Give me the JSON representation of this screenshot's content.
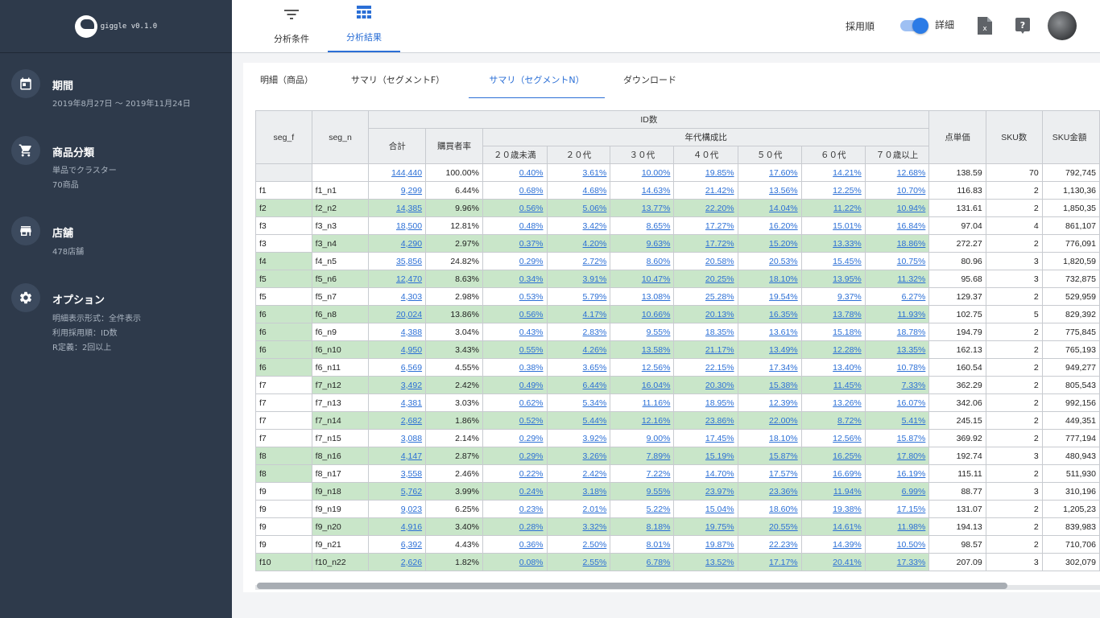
{
  "app": {
    "name": "giggle v0.1.0"
  },
  "sidebar": {
    "period": {
      "title": "期間",
      "lines": [
        "2019年8月27日 〜 2019年11月24日"
      ]
    },
    "category": {
      "title": "商品分類",
      "lines": [
        "単品でクラスター",
        "70商品"
      ]
    },
    "store": {
      "title": "店舗",
      "lines": [
        "478店舗"
      ]
    },
    "options": {
      "title": "オプション",
      "lines": [
        "明細表示形式：全件表示",
        "利用採用順：ID数",
        "R定義：2回以上"
      ]
    }
  },
  "topnav": {
    "tabs": [
      {
        "label": "分析条件",
        "icon": "filter-icon",
        "active": false
      },
      {
        "label": "分析結果",
        "icon": "table-icon",
        "active": true
      }
    ],
    "sort_label": "採用順",
    "detail_label": "詳細",
    "toggle_on": true
  },
  "subtabs": [
    {
      "label": "明細（商品）",
      "active": false
    },
    {
      "label": "サマリ（セグメントF）",
      "active": false
    },
    {
      "label": "サマリ（セグメントN）",
      "active": true
    },
    {
      "label": "ダウンロード",
      "active": false
    }
  ],
  "table": {
    "headers": {
      "seg_f": "seg_f",
      "seg_n": "seg_n",
      "id_count": "ID数",
      "total": "合計",
      "buyer_rate": "購買者率",
      "age_comp": "年代構成比",
      "ages": [
        "２０歳未満",
        "２０代",
        "３０代",
        "４０代",
        "５０代",
        "６０代",
        "７０歳以上"
      ],
      "unit_price": "点単価",
      "sku_count": "SKU数",
      "sku_amount": "SKU金額"
    },
    "total_row": {
      "seg_f": "",
      "seg_n": "",
      "total": "144,440",
      "rate": "100.00%",
      "ages": [
        "0.40%",
        "3.61%",
        "10.00%",
        "19.85%",
        "17.60%",
        "14.21%",
        "12.68%"
      ],
      "price": "138.59",
      "sku": "70",
      "amount": "792,745"
    },
    "rows": [
      {
        "f": "f1",
        "n": "f1_n1",
        "g": false,
        "total": "9,299",
        "rate": "6.44%",
        "ages": [
          "0.68%",
          "4.68%",
          "14.63%",
          "21.42%",
          "13.56%",
          "12.25%",
          "10.70%"
        ],
        "price": "116.83",
        "sku": "2",
        "amount": "1,130,36"
      },
      {
        "f": "f2",
        "n": "f2_n2",
        "g": true,
        "total": "14,385",
        "rate": "9.96%",
        "ages": [
          "0.56%",
          "5.06%",
          "13.77%",
          "22.20%",
          "14.04%",
          "11.22%",
          "10.94%"
        ],
        "price": "131.61",
        "sku": "2",
        "amount": "1,850,35"
      },
      {
        "f": "f3",
        "n": "f3_n3",
        "g": false,
        "total": "18,500",
        "rate": "12.81%",
        "ages": [
          "0.48%",
          "3.42%",
          "8.65%",
          "17.27%",
          "16.20%",
          "15.01%",
          "16.84%"
        ],
        "price": "97.04",
        "sku": "4",
        "amount": "861,107"
      },
      {
        "f": "f3",
        "n": "f3_n4",
        "g": true,
        "fg": false,
        "total": "4,290",
        "rate": "2.97%",
        "ages": [
          "0.37%",
          "4.20%",
          "9.63%",
          "17.72%",
          "15.20%",
          "13.33%",
          "18.86%"
        ],
        "price": "272.27",
        "sku": "2",
        "amount": "776,091"
      },
      {
        "f": "f4",
        "n": "f4_n5",
        "g": false,
        "fg": true,
        "total": "35,856",
        "rate": "24.82%",
        "ages": [
          "0.29%",
          "2.72%",
          "8.60%",
          "20.58%",
          "20.53%",
          "15.45%",
          "10.75%"
        ],
        "price": "80.96",
        "sku": "3",
        "amount": "1,820,59"
      },
      {
        "f": "f5",
        "n": "f5_n6",
        "g": true,
        "total": "12,470",
        "rate": "8.63%",
        "ages": [
          "0.34%",
          "3.91%",
          "10.47%",
          "20.25%",
          "18.10%",
          "13.95%",
          "11.32%"
        ],
        "price": "95.68",
        "sku": "3",
        "amount": "732,875"
      },
      {
        "f": "f5",
        "n": "f5_n7",
        "g": false,
        "total": "4,303",
        "rate": "2.98%",
        "ages": [
          "0.53%",
          "5.79%",
          "13.08%",
          "25.28%",
          "19.54%",
          "9.37%",
          "6.27%"
        ],
        "price": "129.37",
        "sku": "2",
        "amount": "529,959"
      },
      {
        "f": "f6",
        "n": "f6_n8",
        "g": true,
        "total": "20,024",
        "rate": "13.86%",
        "ages": [
          "0.56%",
          "4.17%",
          "10.66%",
          "20.13%",
          "16.35%",
          "13.78%",
          "11.93%"
        ],
        "price": "102.75",
        "sku": "5",
        "amount": "829,392"
      },
      {
        "f": "f6",
        "n": "f6_n9",
        "g": false,
        "fg": true,
        "total": "4,388",
        "rate": "3.04%",
        "ages": [
          "0.43%",
          "2.83%",
          "9.55%",
          "18.35%",
          "13.61%",
          "15.18%",
          "18.78%"
        ],
        "price": "194.79",
        "sku": "2",
        "amount": "775,845"
      },
      {
        "f": "f6",
        "n": "f6_n10",
        "g": true,
        "total": "4,950",
        "rate": "3.43%",
        "ages": [
          "0.55%",
          "4.26%",
          "13.58%",
          "21.17%",
          "13.49%",
          "12.28%",
          "13.35%"
        ],
        "price": "162.13",
        "sku": "2",
        "amount": "765,193"
      },
      {
        "f": "f6",
        "n": "f6_n11",
        "g": false,
        "fg": true,
        "total": "6,569",
        "rate": "4.55%",
        "ages": [
          "0.38%",
          "3.65%",
          "12.56%",
          "22.15%",
          "17.34%",
          "13.40%",
          "10.78%"
        ],
        "price": "160.54",
        "sku": "2",
        "amount": "949,277"
      },
      {
        "f": "f7",
        "n": "f7_n12",
        "g": true,
        "fg": false,
        "total": "3,492",
        "rate": "2.42%",
        "ages": [
          "0.49%",
          "6.44%",
          "16.04%",
          "20.30%",
          "15.38%",
          "11.45%",
          "7.33%"
        ],
        "price": "362.29",
        "sku": "2",
        "amount": "805,543"
      },
      {
        "f": "f7",
        "n": "f7_n13",
        "g": false,
        "total": "4,381",
        "rate": "3.03%",
        "ages": [
          "0.62%",
          "5.34%",
          "11.16%",
          "18.95%",
          "12.39%",
          "13.26%",
          "16.07%"
        ],
        "price": "342.06",
        "sku": "2",
        "amount": "992,156"
      },
      {
        "f": "f7",
        "n": "f7_n14",
        "g": true,
        "fg": false,
        "total": "2,682",
        "rate": "1.86%",
        "ages": [
          "0.52%",
          "5.44%",
          "12.16%",
          "23.86%",
          "22.00%",
          "8.72%",
          "5.41%"
        ],
        "price": "245.15",
        "sku": "2",
        "amount": "449,351"
      },
      {
        "f": "f7",
        "n": "f7_n15",
        "g": false,
        "total": "3,088",
        "rate": "2.14%",
        "ages": [
          "0.29%",
          "3.92%",
          "9.00%",
          "17.45%",
          "18.10%",
          "12.56%",
          "15.87%"
        ],
        "price": "369.92",
        "sku": "2",
        "amount": "777,194"
      },
      {
        "f": "f8",
        "n": "f8_n16",
        "g": true,
        "total": "4,147",
        "rate": "2.87%",
        "ages": [
          "0.29%",
          "3.26%",
          "7.89%",
          "15.19%",
          "15.87%",
          "16.25%",
          "17.80%"
        ],
        "price": "192.74",
        "sku": "3",
        "amount": "480,943"
      },
      {
        "f": "f8",
        "n": "f8_n17",
        "g": false,
        "fg": true,
        "total": "3,558",
        "rate": "2.46%",
        "ages": [
          "0.22%",
          "2.42%",
          "7.22%",
          "14.70%",
          "17.57%",
          "16.69%",
          "16.19%"
        ],
        "price": "115.11",
        "sku": "2",
        "amount": "511,930"
      },
      {
        "f": "f9",
        "n": "f9_n18",
        "g": true,
        "fg": false,
        "total": "5,762",
        "rate": "3.99%",
        "ages": [
          "0.24%",
          "3.18%",
          "9.55%",
          "23.97%",
          "23.36%",
          "11.94%",
          "6.99%"
        ],
        "price": "88.77",
        "sku": "3",
        "amount": "310,196"
      },
      {
        "f": "f9",
        "n": "f9_n19",
        "g": false,
        "total": "9,023",
        "rate": "6.25%",
        "ages": [
          "0.23%",
          "2.01%",
          "5.22%",
          "15.04%",
          "18.60%",
          "19.38%",
          "17.15%"
        ],
        "price": "131.07",
        "sku": "2",
        "amount": "1,205,23"
      },
      {
        "f": "f9",
        "n": "f9_n20",
        "g": true,
        "fg": false,
        "total": "4,916",
        "rate": "3.40%",
        "ages": [
          "0.28%",
          "3.32%",
          "8.18%",
          "19.75%",
          "20.55%",
          "14.61%",
          "11.98%"
        ],
        "price": "194.13",
        "sku": "2",
        "amount": "839,983"
      },
      {
        "f": "f9",
        "n": "f9_n21",
        "g": false,
        "total": "6,392",
        "rate": "4.43%",
        "ages": [
          "0.36%",
          "2.50%",
          "8.01%",
          "19.87%",
          "22.23%",
          "14.39%",
          "10.50%"
        ],
        "price": "98.57",
        "sku": "2",
        "amount": "710,706"
      },
      {
        "f": "f10",
        "n": "f10_n22",
        "g": true,
        "total": "2,626",
        "rate": "1.82%",
        "ages": [
          "0.08%",
          "2.55%",
          "6.78%",
          "13.52%",
          "17.17%",
          "20.41%",
          "17.33%"
        ],
        "price": "207.09",
        "sku": "3",
        "amount": "302,079"
      }
    ]
  }
}
